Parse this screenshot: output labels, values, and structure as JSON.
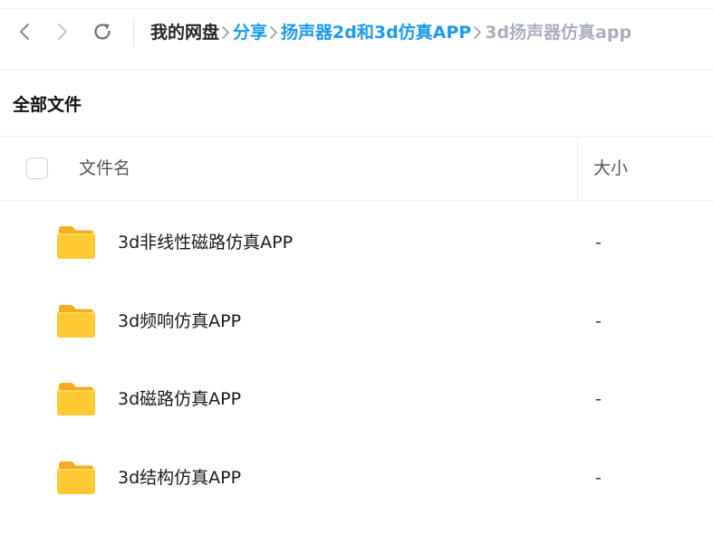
{
  "navigation": {
    "back_icon": "chevron-left-icon",
    "forward_icon": "chevron-right-icon",
    "refresh_icon": "refresh-icon"
  },
  "breadcrumb": {
    "items": [
      {
        "label": "我的网盘",
        "state": "root"
      },
      {
        "label": "分享",
        "state": "link"
      },
      {
        "label": "扬声器2d和3d仿真APP",
        "state": "link"
      },
      {
        "label": "3d扬声器仿真app",
        "state": "current"
      }
    ],
    "separator_icon": "chevron-right-icon"
  },
  "section": {
    "title": "全部文件"
  },
  "table": {
    "columns": {
      "name": "文件名",
      "size": "大小"
    },
    "rows": [
      {
        "name": "3d非线性磁路仿真APP",
        "size": "-",
        "icon": "folder-icon"
      },
      {
        "name": "3d频响仿真APP",
        "size": "-",
        "icon": "folder-icon"
      },
      {
        "name": "3d磁路仿真APP",
        "size": "-",
        "icon": "folder-icon"
      },
      {
        "name": "3d结构仿真APP",
        "size": "-",
        "icon": "folder-icon"
      }
    ]
  },
  "colors": {
    "link": "#1a9af0",
    "current_crumb": "#a9b0bb",
    "folder_body": "#ffc933",
    "folder_tab": "#f7ac1b"
  }
}
